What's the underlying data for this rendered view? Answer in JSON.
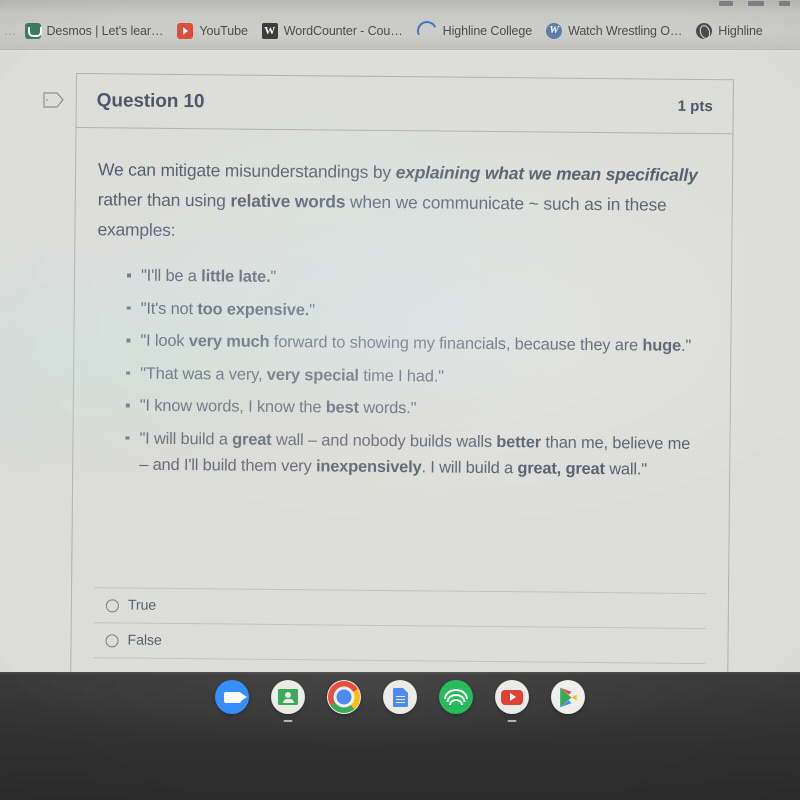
{
  "browser": {
    "bookmarks": [
      {
        "label": "Desmos | Let's lear…",
        "icon": "desmos-icon"
      },
      {
        "label": "YouTube",
        "icon": "youtube-icon"
      },
      {
        "label": "WordCounter - Cou…",
        "icon": "wordcounter-icon"
      },
      {
        "label": "Highline College",
        "icon": "highline-ring-icon"
      },
      {
        "label": "Watch Wrestling O…",
        "icon": "wordpress-icon"
      },
      {
        "label": "Highline",
        "icon": "globe-icon"
      }
    ],
    "overflow_left": "…"
  },
  "question": {
    "flag_icon": "flag-icon",
    "title": "Question 10",
    "points": "1 pts",
    "prompt": {
      "seg1": "We can mitigate misunderstandings by ",
      "seg2_em": "explaining what we mean specifically",
      "seg3": " rather than using ",
      "seg4_strong": "relative words",
      "seg5": " when we communicate ~ such as in these examples:"
    },
    "examples": [
      {
        "pre": "\"I'll be a ",
        "strong": "little late.",
        "post": "\""
      },
      {
        "pre": "\"It's not ",
        "strong": "too expensive.",
        "post": "\""
      },
      {
        "pre": "\"I look ",
        "strong": "very much",
        "post": " forward to showing my financials, because they are ",
        "strong2": "huge",
        "post2": ".\""
      },
      {
        "pre": "\"That was a very, ",
        "strong": "very special",
        "post": " time I had.\""
      },
      {
        "pre": "\"I know words, I know the ",
        "strong": "best",
        "post": " words.\""
      },
      {
        "pre": "\"I will build a ",
        "strong": "great",
        "post": " wall – and nobody builds walls ",
        "strong2": "better",
        "post2": " than me, believe me – and I'll build them very ",
        "strong3": "inexpensively",
        "post3": ". I will build a ",
        "strong4": "great, great",
        "post4": " wall.\""
      }
    ],
    "answers": [
      {
        "label": "True",
        "selected": false
      },
      {
        "label": "False",
        "selected": false
      }
    ]
  },
  "shelf": {
    "apps": [
      {
        "name": "zoom",
        "label": "Zoom",
        "running": false
      },
      {
        "name": "classroom",
        "label": "Google Classroom",
        "running": true
      },
      {
        "name": "chrome",
        "label": "Google Chrome",
        "running": true
      },
      {
        "name": "docs",
        "label": "Google Docs",
        "running": false
      },
      {
        "name": "spotify",
        "label": "Spotify",
        "running": false
      },
      {
        "name": "youtube",
        "label": "YouTube",
        "running": true
      },
      {
        "name": "play",
        "label": "Play Store",
        "running": false
      }
    ]
  },
  "colors": {
    "page_background": "#dfe0dc",
    "bookmark_bar": "#cfd0cc",
    "text": "#525a6b",
    "card_border": "#b2b3af",
    "shelf": "#303030"
  }
}
